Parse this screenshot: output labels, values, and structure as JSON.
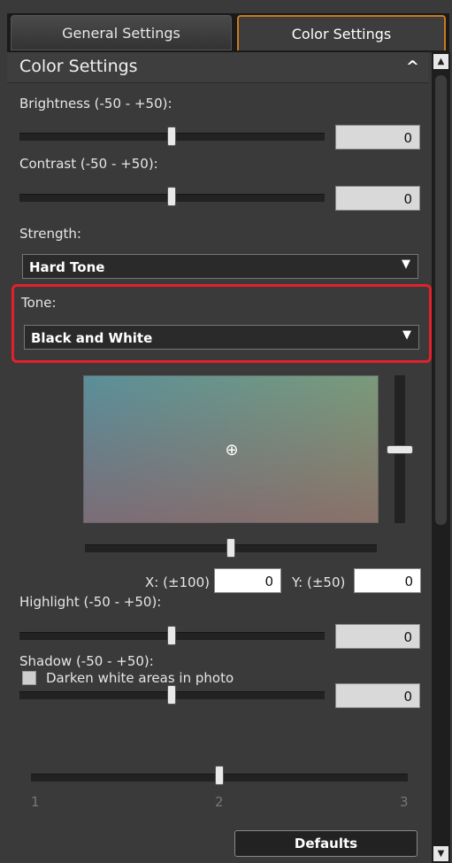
{
  "tabs": [
    {
      "label": "General Settings",
      "active": false
    },
    {
      "label": "Color Settings",
      "active": true
    }
  ],
  "section": {
    "title": "Color Settings",
    "collapse_icon": "chevron-up-icon"
  },
  "brightness": {
    "label": "Brightness (-50 - +50):",
    "value": "0"
  },
  "contrast": {
    "label": "Contrast (-50 - +50):",
    "value": "0"
  },
  "strength": {
    "label": "Strength:",
    "selected": "Hard Tone"
  },
  "tone": {
    "label": "Tone:",
    "selected": "Black and White"
  },
  "color_adjust": {
    "x_label": "X: (±100)",
    "x_value": "0",
    "y_label": "Y: (±50)",
    "y_value": "0"
  },
  "highlight": {
    "label": "Highlight (-50 - +50):",
    "value": "0"
  },
  "shadow": {
    "label": "Shadow (-50 - +50):",
    "value": "0"
  },
  "darken": {
    "label": "Darken white areas in photo",
    "checked": false
  },
  "darken_scale": {
    "ticks": [
      "1",
      "2",
      "3"
    ],
    "level": 2
  },
  "defaults_label": "Defaults",
  "colors": {
    "accent_tab": "#c97a1c",
    "highlight_border": "#e4202c",
    "background": "#3a3a3a"
  }
}
